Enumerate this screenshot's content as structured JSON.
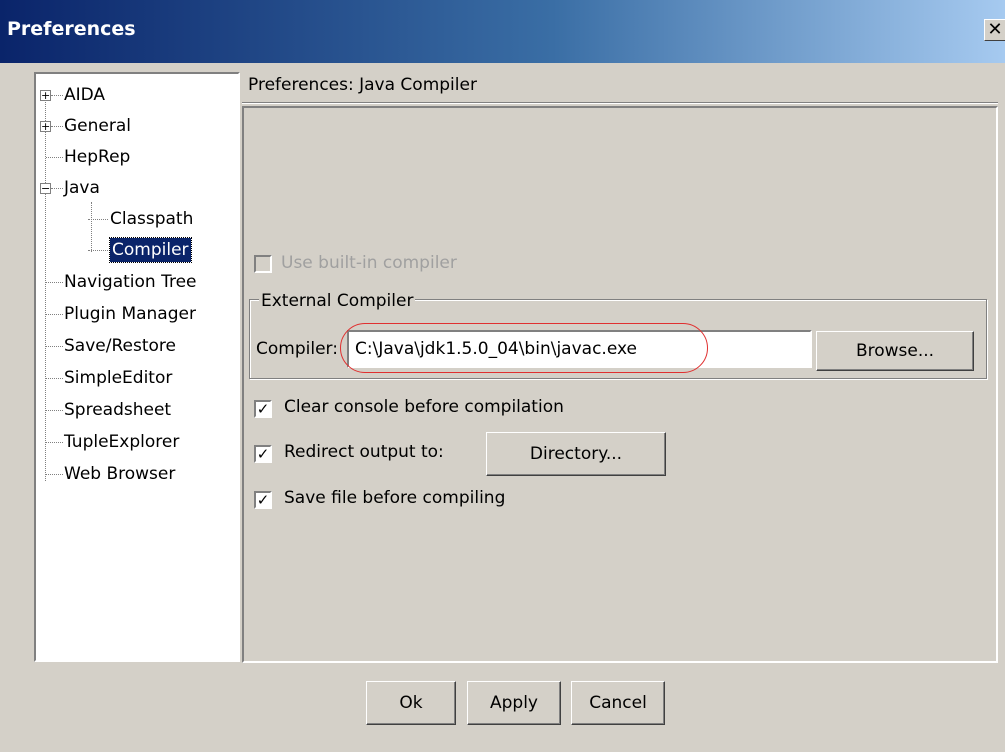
{
  "window": {
    "title": "Preferences",
    "close_glyph": "✕"
  },
  "tree": {
    "items": [
      {
        "label": "AIDA",
        "expander": "+"
      },
      {
        "label": "General",
        "expander": "+"
      },
      {
        "label": "HepRep"
      },
      {
        "label": "Java",
        "expander": "−"
      },
      {
        "label": "Classpath"
      },
      {
        "label": "Compiler",
        "selected": true
      },
      {
        "label": "Navigation Tree"
      },
      {
        "label": "Plugin Manager"
      },
      {
        "label": "Save/Restore"
      },
      {
        "label": "SimpleEditor"
      },
      {
        "label": "Spreadsheet"
      },
      {
        "label": "TupleExplorer"
      },
      {
        "label": "Web Browser"
      }
    ]
  },
  "pane": {
    "title": "Preferences: Java Compiler"
  },
  "compiler": {
    "use_builtin_label": "Use built-in compiler",
    "use_builtin_checked": false,
    "group_label": "External Compiler",
    "compiler_label": "Compiler:",
    "compiler_path": "C:\\Java\\jdk1.5.0_04\\bin\\javac.exe",
    "browse_label": "Browse...",
    "clear_console_label": "Clear console before compilation",
    "clear_console_checked": true,
    "redirect_label": "Redirect output to:",
    "redirect_checked": true,
    "directory_label": "Directory...",
    "save_file_label": "Save file before compiling",
    "save_file_checked": true,
    "check_glyph": "✓"
  },
  "buttons": {
    "ok": "Ok",
    "apply": "Apply",
    "cancel": "Cancel"
  },
  "colors": {
    "title_bar": "#0a246a",
    "selection": "#0a246a",
    "highlight_ellipse": "#e03030",
    "dialog_bg": "#d4d0c8"
  }
}
